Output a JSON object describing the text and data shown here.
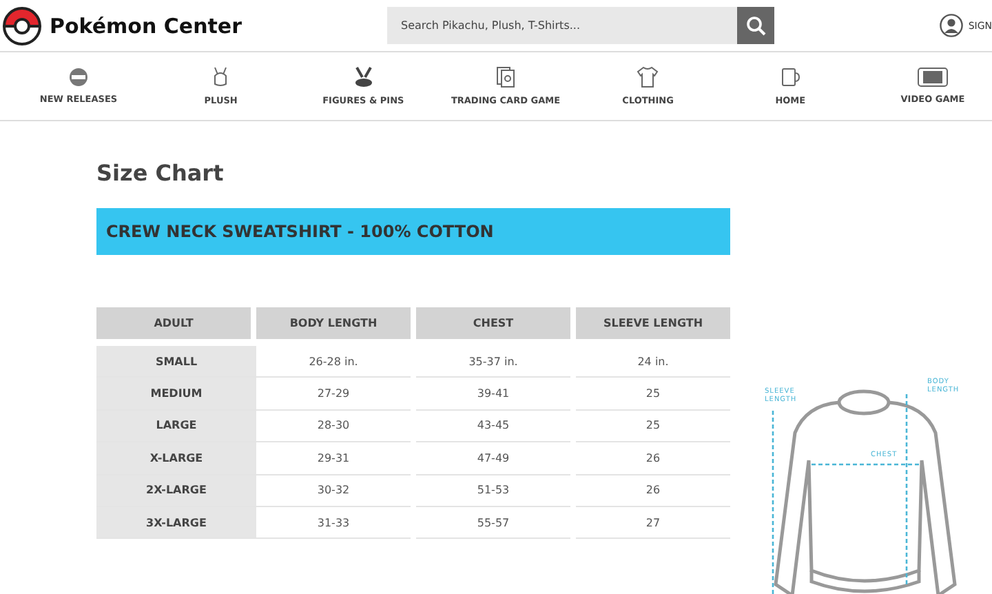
{
  "header": {
    "logo": "Pokémon Center",
    "search": {
      "placeholder": "Search Pikachu, Plush, T-Shirts..."
    },
    "account": "SIGN"
  },
  "nav": [
    {
      "label": "NEW RELEASES"
    },
    {
      "label": "PLUSH"
    },
    {
      "label": "FIGURES & PINS"
    },
    {
      "label": "TRADING CARD GAME"
    },
    {
      "label": "CLOTHING"
    },
    {
      "label": "HOME"
    },
    {
      "label": "VIDEO GAME"
    }
  ],
  "title": "Size Chart",
  "banner": "CREW NECK SWEATSHIRT - 100% COTTON",
  "table": {
    "columns": [
      "ADULT",
      "BODY LENGTH",
      "CHEST",
      "SLEEVE LENGTH"
    ],
    "rows": [
      [
        "SMALL",
        "26-28 in.",
        "35-37 in.",
        "24 in."
      ],
      [
        "MEDIUM",
        "27-29",
        "39-41",
        "25"
      ],
      [
        "LARGE",
        "28-30",
        "43-45",
        "25"
      ],
      [
        "X-LARGE",
        "29-31",
        "47-49",
        "26"
      ],
      [
        "2X-LARGE",
        "30-32",
        "51-53",
        "26"
      ],
      [
        "3X-LARGE",
        "31-33",
        "55-57",
        "27"
      ]
    ]
  },
  "diagram": {
    "sleeve_label": "SLEEVE LENGTH",
    "body_label": "BODY LENGTH",
    "chest_label": "CHEST"
  }
}
